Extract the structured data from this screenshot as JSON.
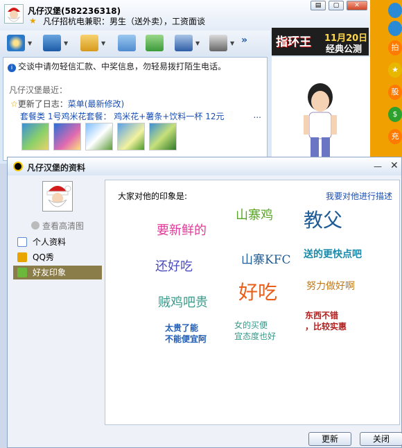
{
  "contact": {
    "name": "凡仔汉堡(582236318)",
    "status": "凡仔招杭电兼职：男生（送外卖），工资面谈"
  },
  "banner": {
    "line1": "指环王",
    "date": "11月20日",
    "sub": "经典公测"
  },
  "side_icons": [
    "拍",
    "股",
    "充"
  ],
  "chat": {
    "notice": "交谈中请勿轻信汇款、中奖信息，勿轻易拨打陌生电话。",
    "recent_label": "凡仔汉堡最近：",
    "diary_prefix": "更新了日志：",
    "diary_title": "菜单(最新修改)",
    "meal_text": "套餐类 1号鸡米花套餐：",
    "meal_items": "鸡米花+薯条+饮料一杯",
    "meal_price": "12元",
    "more": "..."
  },
  "profile": {
    "title": "凡仔汉堡的资料",
    "hd_label": "查看高清图",
    "nav": [
      "个人资料",
      "QQ秀",
      "好友印象"
    ],
    "impression_header": "大家对他的印象是:",
    "describe_link": "我要对他进行描述",
    "words": [
      "山寨鸡",
      "教父",
      "要新鲜的",
      "山寨KFC",
      "送的更快点吧",
      "还好吃",
      "好吃",
      "努力做好啊",
      "贼鸡吧贵",
      "太贵了能",
      "不能便宜阿",
      "女的买便",
      "宜态度也好",
      "东西不错",
      "，比较实惠"
    ],
    "update_button": "更新",
    "close_button": "关闭"
  },
  "colors": {
    "green": "#5aa528",
    "blue_dark": "#1f5c96",
    "pink": "#e0399a",
    "purple": "#4a4abf",
    "teal": "#3a9a8a",
    "orange": "#e85f1a",
    "brown": "#c07a1a",
    "red": "#b21f1f",
    "cyan": "#1a8aaa"
  }
}
